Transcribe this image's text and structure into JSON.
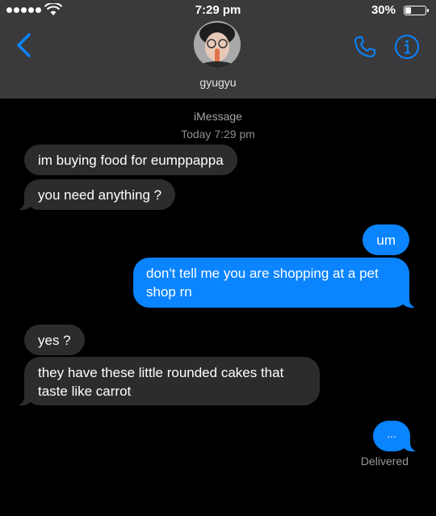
{
  "status_bar": {
    "time": "7:29 pm",
    "battery_percent": "30%",
    "battery_level": 0.3,
    "signal_dots": 5,
    "wifi_icon": "wifi-icon"
  },
  "header": {
    "contact_name": "gyugyu",
    "back_icon": "chevron-left-icon",
    "call_icon": "phone-icon",
    "info_icon": "info-icon",
    "accent_color": "#0b84ff"
  },
  "thread": {
    "service_label": "iMessage",
    "timestamp": "Today 7:29 pm",
    "messages": [
      {
        "from": "them",
        "text": "im buying food for eumppappa"
      },
      {
        "from": "them",
        "text": "you need anything ?"
      },
      {
        "from": "me",
        "text": "um"
      },
      {
        "from": "me",
        "text": "don't tell me you are shopping at a pet shop rn"
      },
      {
        "from": "them",
        "text": "yes ?"
      },
      {
        "from": "them",
        "text": "they have these little rounded cakes that taste like carrot"
      },
      {
        "from": "me",
        "text": "..."
      }
    ],
    "delivery_status": "Delivered"
  },
  "colors": {
    "header_bg": "#3a3a3c",
    "incoming_bubble": "#2c2c2e",
    "outgoing_bubble": "#0b84ff",
    "background": "#000000"
  }
}
